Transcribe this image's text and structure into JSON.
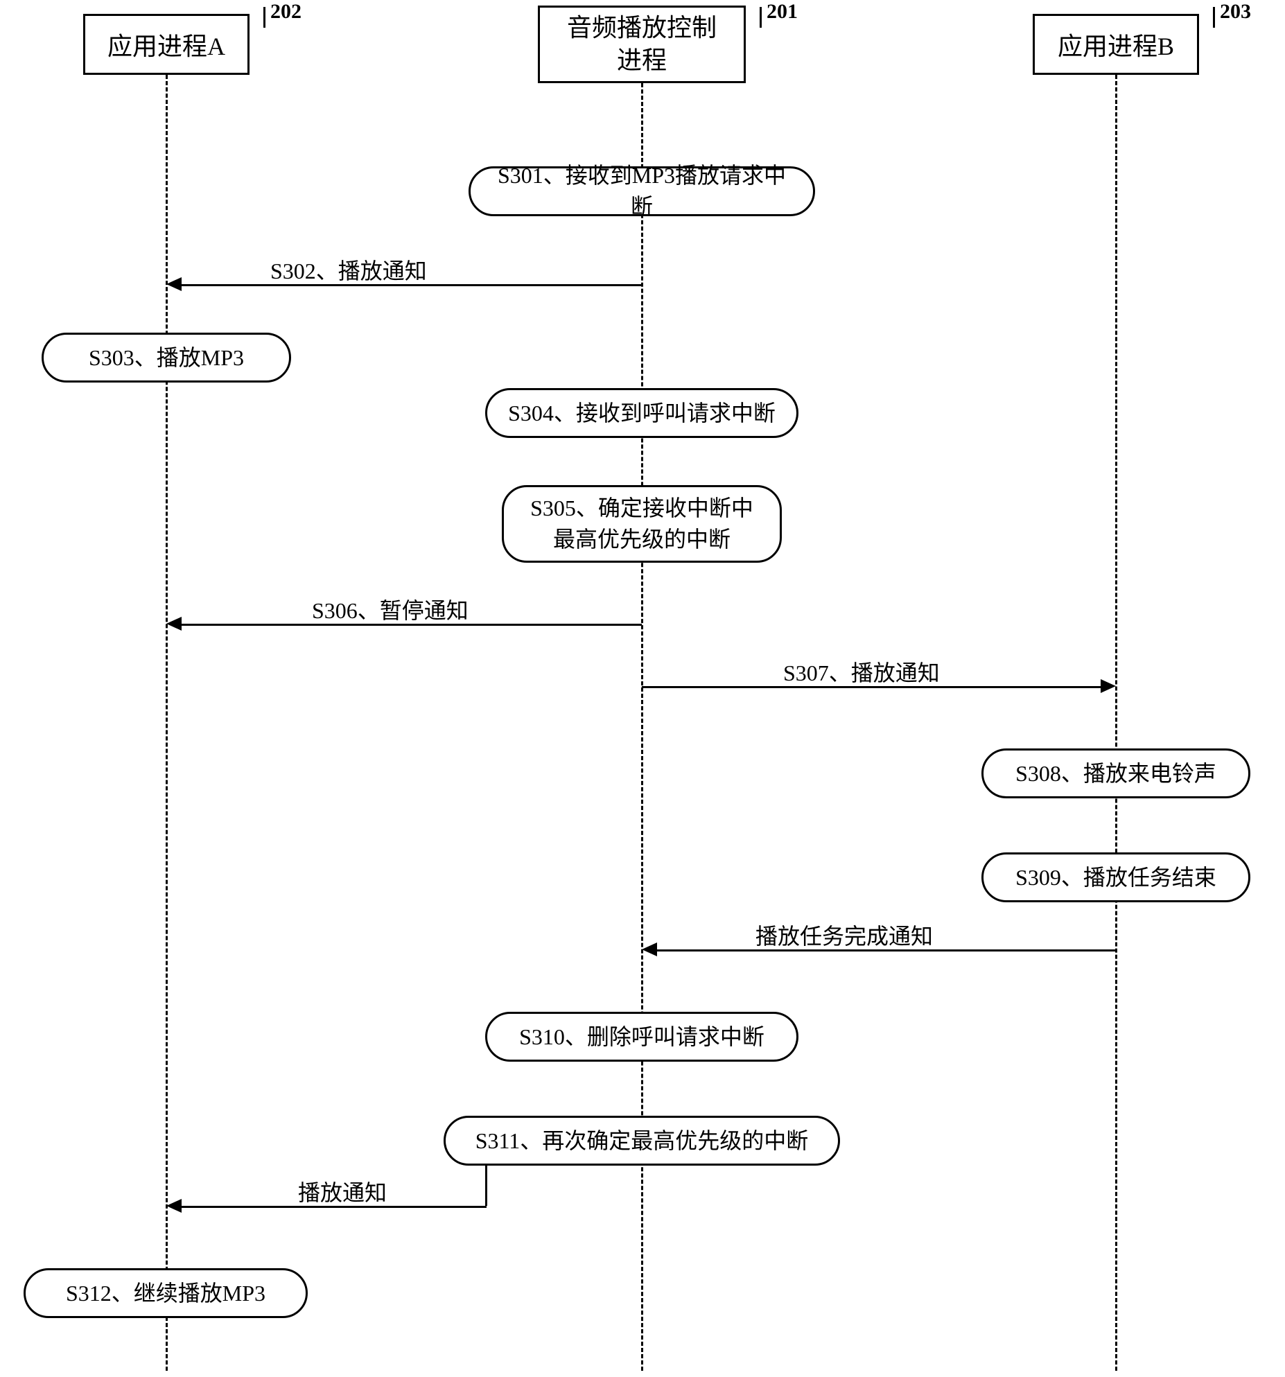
{
  "lifelines": {
    "a": {
      "title": "应用进程A",
      "ref": "202"
    },
    "ctrl": {
      "title": "音频播放控制\n进程",
      "ref": "201"
    },
    "b": {
      "title": "应用进程B",
      "ref": "203"
    }
  },
  "steps": {
    "s301": "S301、接收到MP3播放请求中断",
    "s302": "S302、播放通知",
    "s303": "S303、播放MP3",
    "s304": "S304、接收到呼叫请求中断",
    "s305": "S305、确定接收中断中\n最高优先级的中断",
    "s306": "S306、暂停通知",
    "s307": "S307、播放通知",
    "s308": "S308、播放来电铃声",
    "s309": "S309、播放任务结束",
    "s310": "S310、删除呼叫请求中断",
    "s311": "S311、再次确定最高优先级的中断",
    "s312": "S312、继续播放MP3",
    "msg_complete": "播放任务完成通知",
    "msg_play": "播放通知"
  }
}
